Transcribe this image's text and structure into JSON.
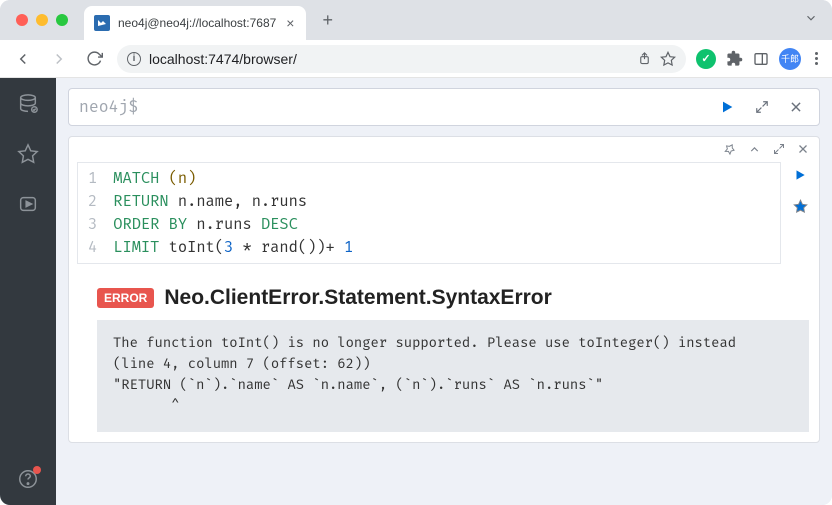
{
  "tab": {
    "title": "neo4j@neo4j://localhost:7687"
  },
  "url": "localhost:7474/browser/",
  "avatar": "千郎",
  "prompt": "neo4j$",
  "code": {
    "lines": [
      "1",
      "2",
      "3",
      "4"
    ],
    "l1_kw": "MATCH ",
    "l1_p": "(n)",
    "l2_kw": "RETURN ",
    "l2_rest": "n.name, n.runs",
    "l3_kw": "ORDER BY ",
    "l3_a": "n.runs ",
    "l3_kw2": "DESC",
    "l4_kw": "LIMIT ",
    "l4_a": "toInt(",
    "l4_n1": "3",
    "l4_b": " * rand())+ ",
    "l4_n2": "1"
  },
  "error": {
    "badge": "ERROR",
    "title": "Neo.ClientError.Statement.SyntaxError",
    "body": "The function toInt() is no longer supported. Please use toInteger() instead\n(line 4, column 7 (offset: 62))\n\"RETURN (`n`).`name` AS `n.name`, (`n`).`runs` AS `n.runs`\"\n       ^"
  }
}
